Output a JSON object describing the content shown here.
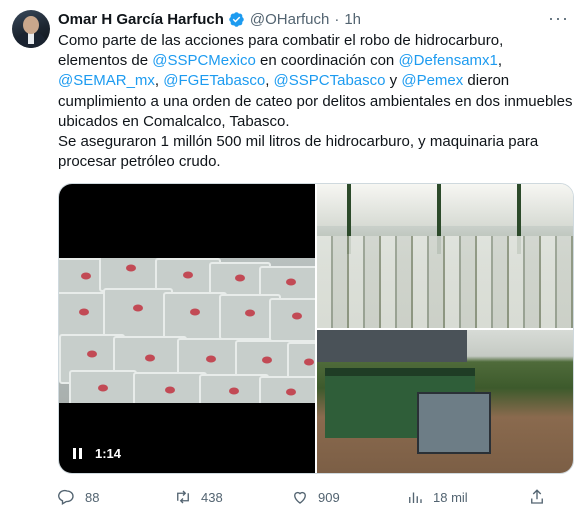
{
  "author": {
    "name": "Omar H García Harfuch",
    "handle": "@OHarfuch",
    "separator": "·",
    "time": "1h",
    "verified_icon": "verified-badge-icon",
    "more_label": "···"
  },
  "tweet": {
    "segments": [
      {
        "type": "text",
        "value": "Como parte de las acciones para combatir el robo de hidrocarburo, elementos de "
      },
      {
        "type": "mention",
        "value": "@SSPCMexico"
      },
      {
        "type": "text",
        "value": " en coordinación con "
      },
      {
        "type": "mention",
        "value": "@Defensamx1"
      },
      {
        "type": "text",
        "value": ", "
      },
      {
        "type": "mention",
        "value": "@SEMAR_mx"
      },
      {
        "type": "text",
        "value": ", "
      },
      {
        "type": "mention",
        "value": "@FGETabasco"
      },
      {
        "type": "text",
        "value": ", "
      },
      {
        "type": "mention",
        "value": "@SSPCTabasco"
      },
      {
        "type": "text",
        "value": " y "
      },
      {
        "type": "mention",
        "value": "@Pemex"
      },
      {
        "type": "text",
        "value": " dieron cumplimiento a una orden de cateo por delitos ambientales en dos inmuebles ubicados en Comalcalco, Tabasco."
      },
      {
        "type": "break"
      },
      {
        "type": "text",
        "value": "Se aseguraron 1 millón 500 mil litros de hidrocarburo, y maquinaria para procesar petróleo crudo."
      }
    ]
  },
  "media": {
    "video_duration": "1:14",
    "pause_icon": "pause-icon"
  },
  "actions": {
    "replies": "88",
    "retweets": "438",
    "likes": "909",
    "views": "18 mil"
  },
  "colors": {
    "link": "#1d9bf0",
    "secondary": "#536471",
    "verified": "#1d9bf0"
  }
}
